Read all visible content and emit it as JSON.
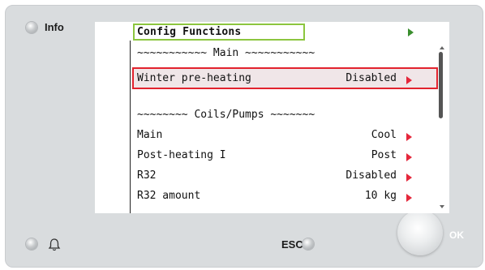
{
  "device": {
    "info_label": "Info",
    "esc_label": "ESC",
    "ok_label": "OK"
  },
  "screen": {
    "title": "Config Functions",
    "main_separator": "~~~~~~~~~~~ Main ~~~~~~~~~~~",
    "coils_separator": "~~~~~~~~ Coils/Pumps ~~~~~~~",
    "items": [
      {
        "name": "Winter pre-heating",
        "value": "Disabled",
        "selected": true
      },
      {
        "name": "Main",
        "value": "Cool",
        "selected": false
      },
      {
        "name": "Post-heating I",
        "value": "Post",
        "selected": false
      },
      {
        "name": "R32",
        "value": "Disabled",
        "selected": false
      },
      {
        "name": "R32 amount",
        "value": "10 kg",
        "selected": false
      }
    ]
  },
  "colors": {
    "title_border": "#8cc63f",
    "selection_border": "#e2232e",
    "arrow_red": "#e5273b",
    "arrow_green": "#3a8e2e"
  }
}
